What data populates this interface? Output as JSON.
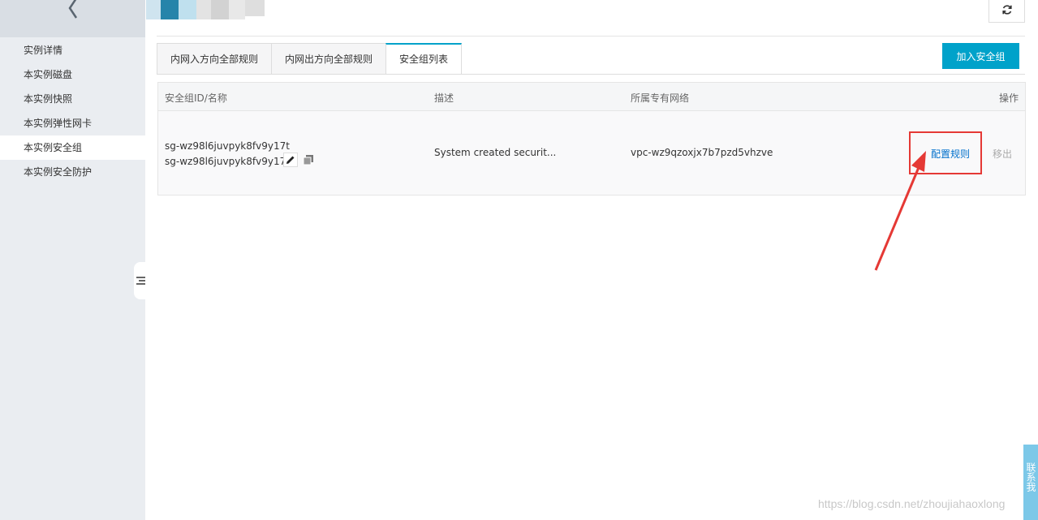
{
  "sidebar": {
    "items": [
      {
        "label": "实例详情",
        "active": false
      },
      {
        "label": "本实例磁盘",
        "active": false
      },
      {
        "label": "本实例快照",
        "active": false
      },
      {
        "label": "本实例弹性网卡",
        "active": false
      },
      {
        "label": "本实例安全组",
        "active": true
      },
      {
        "label": "本实例安全防护",
        "active": false
      }
    ]
  },
  "tabs": [
    {
      "label": "内网入方向全部规则",
      "active": false
    },
    {
      "label": "内网出方向全部规则",
      "active": false
    },
    {
      "label": "安全组列表",
      "active": true
    }
  ],
  "toolbar": {
    "add_label": "加入安全组"
  },
  "table": {
    "headers": [
      "安全组ID/名称",
      "描述",
      "所属专有网络",
      "操作"
    ],
    "rows": [
      {
        "id": "sg-wz98l6juvpyk8fv9y17t",
        "name": "sg-wz98l6juvpyk8fv9y17...",
        "description": "System created securit...",
        "vpc": "vpc-wz9qzoxjx7b7pzd5vhzve",
        "action_config": "配置规则",
        "action_remove": "移出"
      }
    ]
  },
  "watermark": "https://blog.csdn.net/zhoujiahaoxlong",
  "float_widget": {
    "label": "联系我"
  },
  "colors": {
    "accent": "#00a2ca",
    "link": "#0070cc",
    "annotation": "#e53935"
  }
}
